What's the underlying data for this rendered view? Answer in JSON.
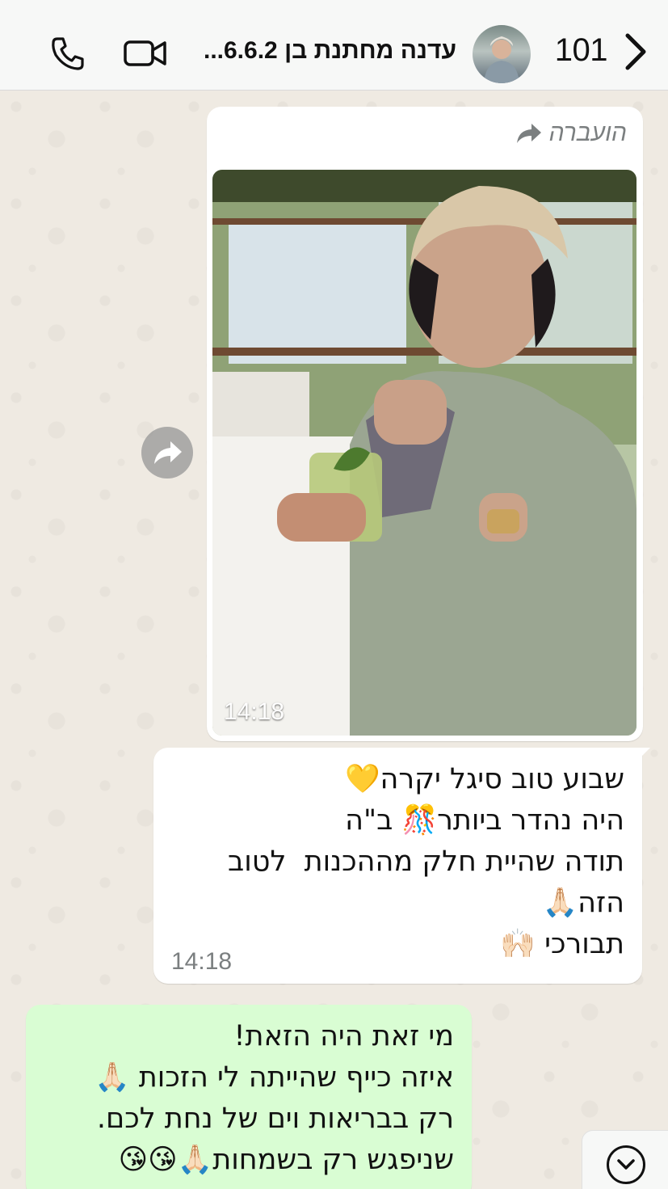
{
  "header": {
    "unread_count": "101",
    "chat_title": "עדנה מחתנת בן 6.6.2...",
    "icons": {
      "back": "chevron-left-icon",
      "video": "video-camera-icon",
      "call": "phone-icon"
    }
  },
  "messages": {
    "photo_msg": {
      "forwarded_label": "הועברה",
      "time": "14:18"
    },
    "incoming_text": {
      "text": "שבוע טוב סיגל יקרה💛\nהיה נהדר ביותר🎊 ב\"ה\nתודה שהיית חלק מההכנות  לטוב\nהזה🙏🏻\nתבורכי 🙌🏻",
      "time": "14:18"
    },
    "outgoing_text": {
      "text": "מי זאת היה הזאת!\nאיזה כייף שהייתה לי הזכות 🙏🏻\nרק בבריאות וים של נחת לכם.\nשניפגש רק בשמחות🙏🏻😘😘"
    }
  },
  "colors": {
    "chat_bg": "#efeae2",
    "incoming_bubble": "#ffffff",
    "outgoing_bubble": "#d9fdd3",
    "header_bg": "#f7f8f7"
  }
}
